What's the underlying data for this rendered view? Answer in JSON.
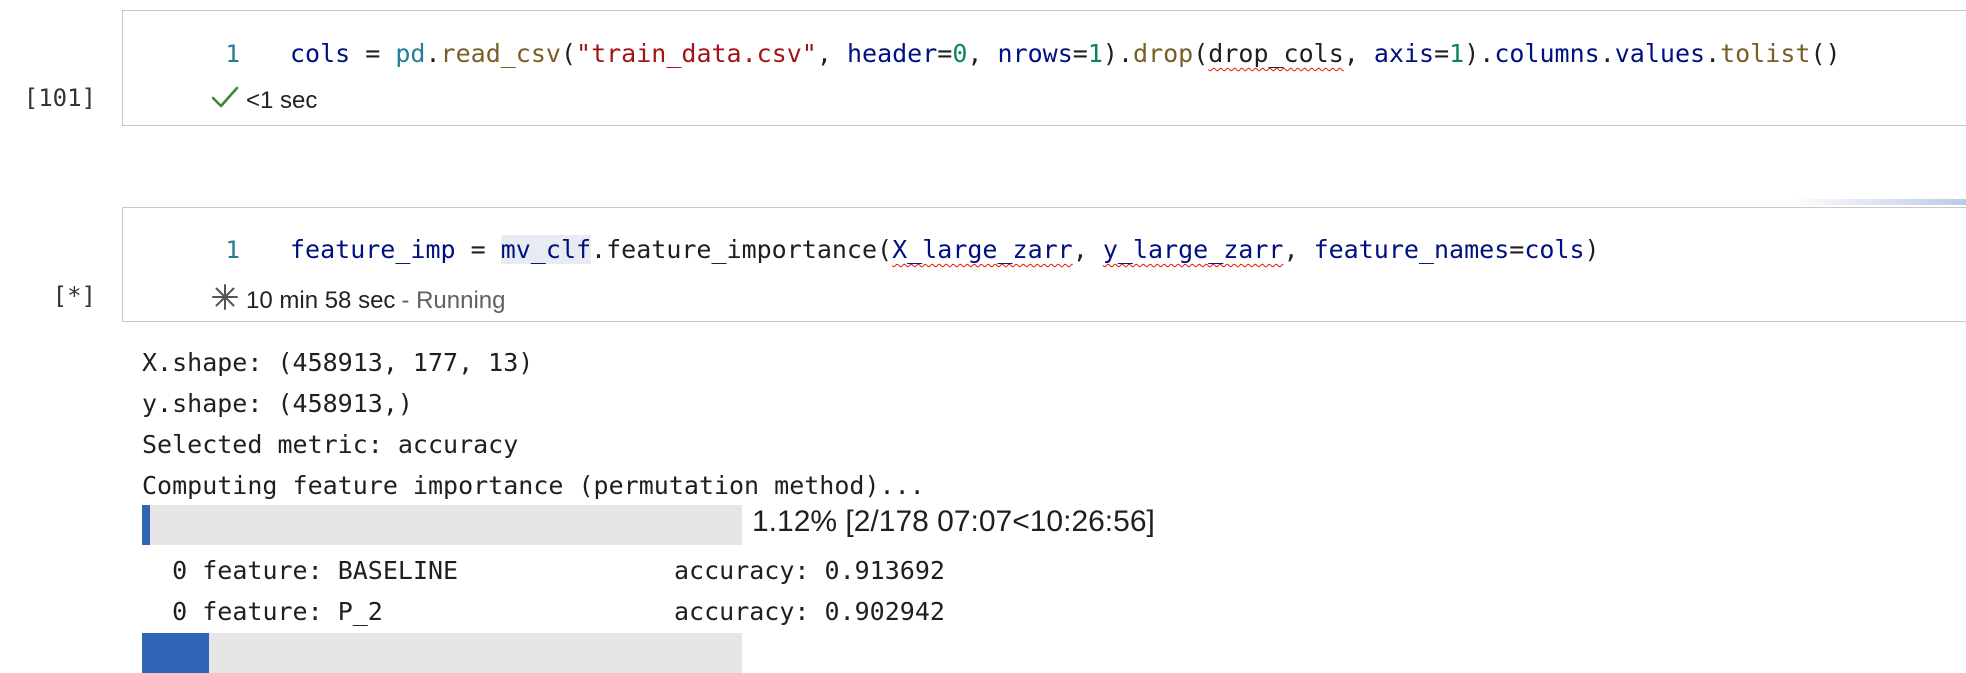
{
  "cell1": {
    "exec_count": "[101]",
    "line_number": "1",
    "code": {
      "t1": "cols",
      "t2": " = ",
      "t3": "pd",
      "t4": ".",
      "t5": "read_csv",
      "t6": "(",
      "t7": "\"train_data.csv\"",
      "t8": ", ",
      "t9": "header",
      "t10": "=",
      "t11": "0",
      "t12": ", ",
      "t13": "nrows",
      "t14": "=",
      "t15": "1",
      "t16": ").",
      "t17": "drop",
      "t18": "(",
      "t19": "drop_cols",
      "t20": ", ",
      "t21": "axis",
      "t22": "=",
      "t23": "1",
      "t24": ").",
      "t25": "columns",
      "t26": ".",
      "t27": "values",
      "t28": ".",
      "t29": "tolist",
      "t30": "()"
    },
    "status_icon": "check-icon",
    "status_time": "<1 sec"
  },
  "cell2": {
    "exec_count": "[*]",
    "line_number": "1",
    "code": {
      "t1": "feature_imp",
      "t2": " = ",
      "t3": "mv_clf",
      "t4": ".",
      "t5": "feature_importance",
      "t6": "(",
      "t7": "X_large_zarr",
      "t8": ", ",
      "t9": "y_large_zarr",
      "t10": ", ",
      "t11": "feature_names",
      "t12": "=",
      "t13": "cols",
      "t14": ")"
    },
    "status_icon": "spinner-icon",
    "status_time": "10 min 58 sec",
    "status_state": " - Running"
  },
  "output": {
    "lines": [
      "X.shape: (458913, 177, 13)",
      "y.shape: (458913,)",
      "Selected metric: accuracy",
      "Computing feature importance (permutation method)..."
    ],
    "progress1": {
      "fraction": 0.0112,
      "text": "1.12% [2/178 07:07<10:26:56]"
    },
    "rows": [
      {
        "idx": "0",
        "feature": "feature: BASELINE",
        "metric": "accuracy: 0.913692"
      },
      {
        "idx": "0",
        "feature": "feature: P_2",
        "metric": "accuracy: 0.902942"
      }
    ],
    "progress2": {
      "fraction": 0.112
    }
  },
  "colors": {
    "check": "#388a34",
    "progress": "#2f65b5",
    "squiggle": "#e51400"
  }
}
